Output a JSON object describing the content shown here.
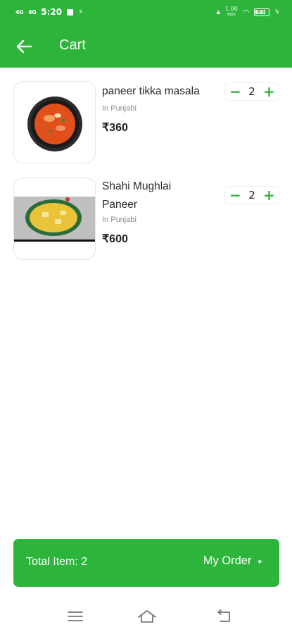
{
  "status_bar": {
    "sig1": "4G",
    "sig2": "4G",
    "time": "5:20",
    "speed_value": "1.00",
    "speed_unit": "KB/S",
    "battery": "85"
  },
  "appbar": {
    "title": "Cart"
  },
  "items": [
    {
      "name": "paneer tikka masala",
      "category": "In Punjabi",
      "price": "₹360",
      "qty": "2"
    },
    {
      "name": "Shahi Mughlai Paneer",
      "category": "In Punjabi",
      "price": "₹600",
      "qty": "2"
    }
  ],
  "stepper": {
    "minus": "−",
    "plus": "+"
  },
  "footer": {
    "total_label": "Total Item: 2",
    "order_label": "My Order",
    "caret": "▸"
  },
  "colors": {
    "accent": "#2db43a"
  },
  "icons": {
    "back": "back-arrow-icon",
    "menu": "menu-icon",
    "home": "home-icon",
    "back_nav": "return-icon"
  }
}
